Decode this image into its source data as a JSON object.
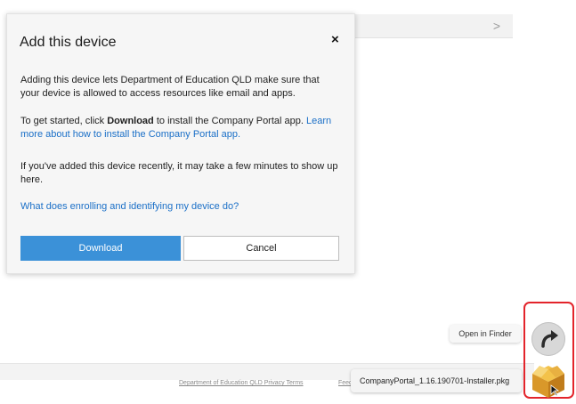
{
  "background": {
    "chevron": ">"
  },
  "dialog": {
    "title": "Add this device",
    "close_label": "×",
    "p1": "Adding this device lets Department of Education QLD make sure that your device is allowed to access resources like email and apps.",
    "p2_prefix": "To get started, click ",
    "p2_bold": "Download",
    "p2_middle": " to install the Company Portal app. ",
    "p2_link": "Learn more about how to install the Company Portal app.",
    "p3": "If you've added this device recently, it may take a few minutes to show up here.",
    "p4_link": "What does enrolling and identifying my device do?",
    "download_label": "Download",
    "cancel_label": "Cancel"
  },
  "footer": {
    "links": [
      "Department of Education QLD Privacy Terms",
      "Feedback"
    ]
  },
  "downloads": {
    "open_in_finder": "Open in Finder",
    "filename": "CompanyPortal_1.16.190701-Installer.pkg"
  },
  "colors": {
    "accent": "#3b91d8",
    "link": "#1a6fc7",
    "highlight": "#e3242b"
  }
}
